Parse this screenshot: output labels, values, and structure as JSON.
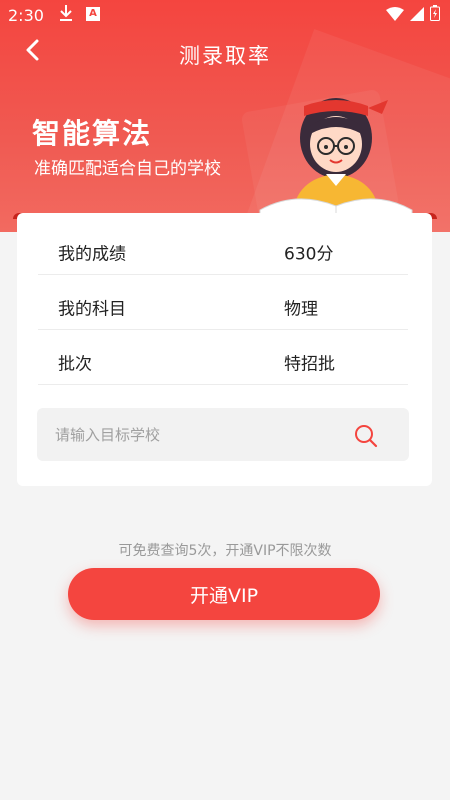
{
  "status_bar": {
    "time": "2:30"
  },
  "nav": {
    "title": "测录取率"
  },
  "hero": {
    "title": "智能算法",
    "subtitle": "准确匹配适合自己的学校"
  },
  "info": {
    "rows": [
      {
        "key": "我的成绩",
        "value": "630分"
      },
      {
        "key": "我的科目",
        "value": "物理"
      },
      {
        "key": "批次",
        "value": "特招批"
      }
    ]
  },
  "search": {
    "placeholder": "请输入目标学校",
    "value": ""
  },
  "footer": {
    "hint": "可免费查询5次，开通VIP不限次数",
    "vip_button": "开通VIP"
  },
  "colors": {
    "primary": "#f4453f",
    "dark_red": "#c7241d"
  }
}
